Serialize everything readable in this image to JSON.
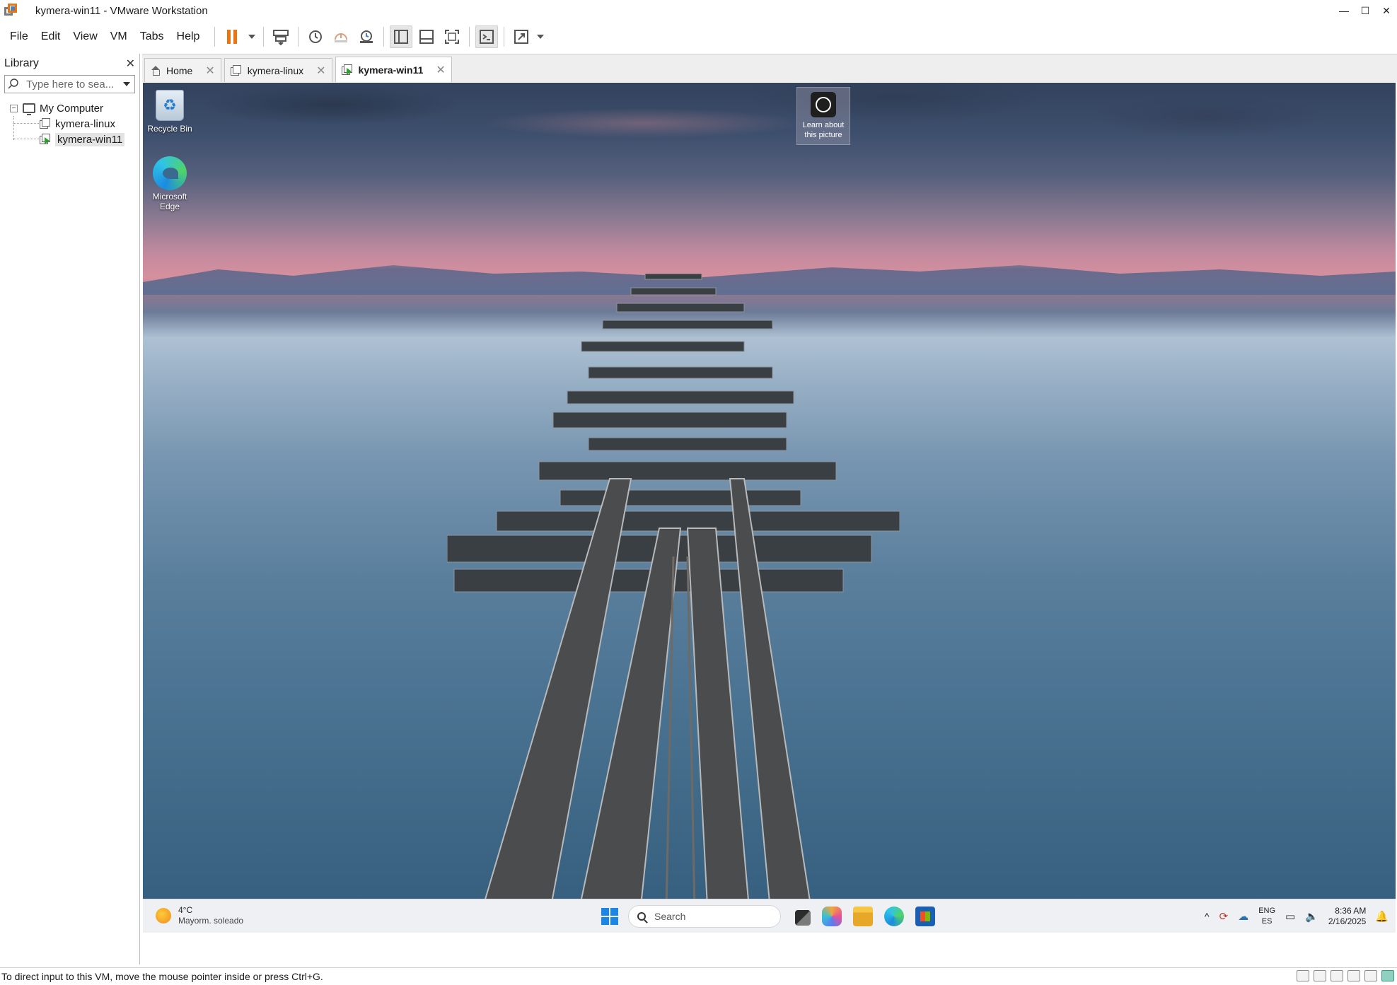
{
  "window": {
    "title": "kymera-win11  - VMware Workstation",
    "controls": {
      "minimize": "—",
      "maximize": "☐",
      "close": "✕"
    }
  },
  "menu": {
    "file": "File",
    "edit": "Edit",
    "view": "View",
    "vm": "VM",
    "tabs": "Tabs",
    "help": "Help"
  },
  "toolbar": {
    "icons": [
      "pause-icon",
      "send-keys-icon",
      "snapshot-icon",
      "revert-snapshot-icon",
      "snapshot-manager-icon",
      "show-library-icon",
      "thumbnail-bar-icon",
      "full-screen-icon",
      "console-icon",
      "stretch-guest-icon"
    ],
    "accent": "#e87511"
  },
  "library": {
    "title": "Library",
    "close": "✕",
    "search_placeholder": "Type here to sea...",
    "root": "My Computer",
    "root_expander": "−",
    "vms": [
      {
        "label": "kymera-linux",
        "running": false
      },
      {
        "label": "kymera-win11",
        "running": true,
        "selected": true
      }
    ]
  },
  "tabs": [
    {
      "label": "Home",
      "close": "✕"
    },
    {
      "label": "kymera-linux",
      "close": "✕"
    },
    {
      "label": "kymera-win11",
      "close": "✕",
      "active": true
    }
  ],
  "desktop": {
    "recycle_bin": "Recycle Bin",
    "edge_line1": "Microsoft",
    "edge_line2": "Edge",
    "learn_line1": "Learn about",
    "learn_line2": "this picture"
  },
  "taskbar": {
    "weather_temp": "4°C",
    "weather_desc": "Mayorm. soleado",
    "search_label": "Search",
    "tray_chevron": "^",
    "lang_top": "ENG",
    "lang_bottom": "ES",
    "time": "8:36 AM",
    "date": "2/16/2025",
    "windows_blue": "#1c86e6"
  },
  "status": {
    "message": "To direct input to this VM, move the mouse pointer inside or press Ctrl+G."
  }
}
